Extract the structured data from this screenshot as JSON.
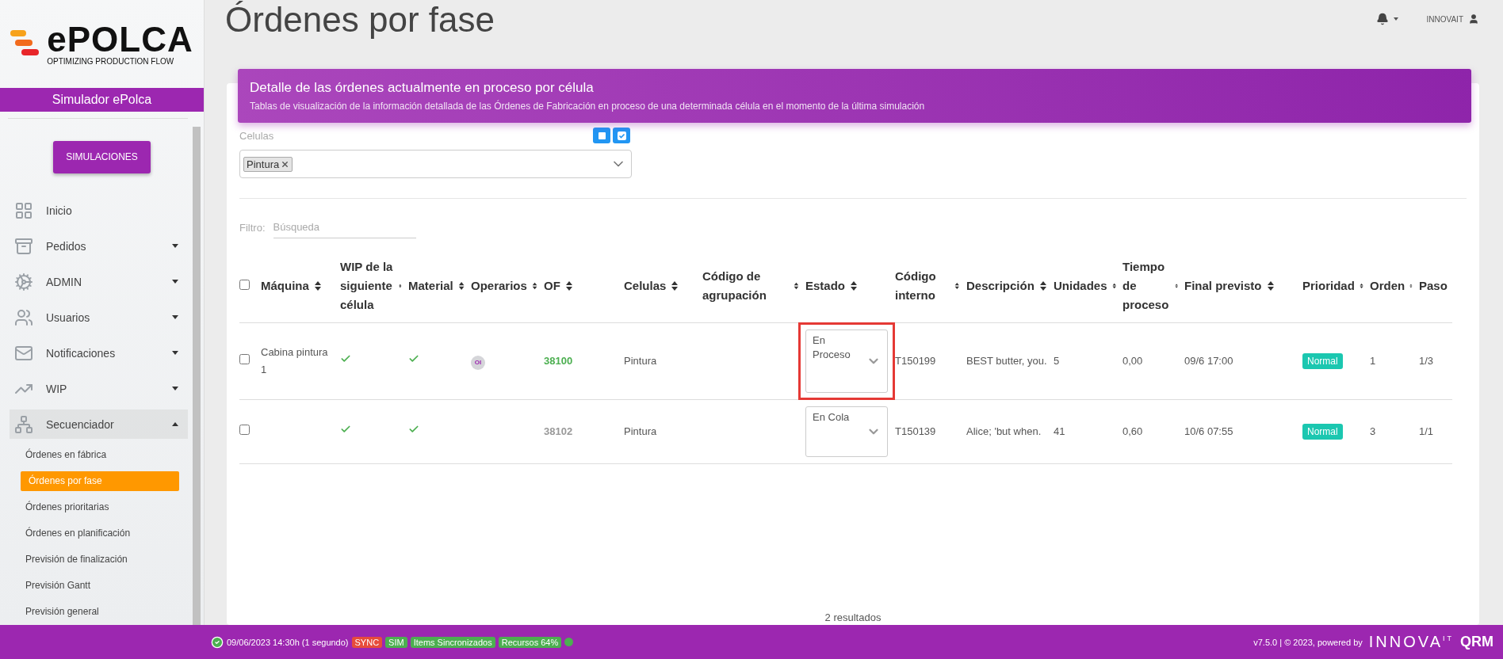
{
  "brand": {
    "name": "ePOLCA",
    "tagline": "OPTIMIZING PRODUCTION FLOW"
  },
  "sidebar": {
    "title": "Simulador ePolca",
    "button": "SIMULACIONES",
    "items": [
      {
        "label": "Inicio",
        "expandable": false,
        "expanded": false
      },
      {
        "label": "Pedidos",
        "expandable": true,
        "expanded": false
      },
      {
        "label": "ADMIN",
        "expandable": true,
        "expanded": false
      },
      {
        "label": "Usuarios",
        "expandable": true,
        "expanded": false
      },
      {
        "label": "Notificaciones",
        "expandable": true,
        "expanded": false
      },
      {
        "label": "WIP",
        "expandable": true,
        "expanded": false
      },
      {
        "label": "Secuenciador",
        "expandable": true,
        "expanded": true,
        "children": [
          {
            "label": "Órdenes en fábrica",
            "selected": false
          },
          {
            "label": "Órdenes por fase",
            "selected": true
          },
          {
            "label": "Órdenes prioritarias",
            "selected": false
          },
          {
            "label": "Órdenes en planificación",
            "selected": false
          },
          {
            "label": "Previsión de finalización",
            "selected": false
          },
          {
            "label": "Previsión Gantt",
            "selected": false
          },
          {
            "label": "Previsión general",
            "selected": false
          }
        ]
      }
    ]
  },
  "page_title": "Órdenes por fase",
  "topbar": {
    "user": "INNOVAIT"
  },
  "banner": {
    "title": "Detalle de las órdenes actualmente en proceso por célula",
    "subtitle": "Tablas de visualización de la información detallada de las Órdenes de Fabricación en proceso de una determinada célula en el momento de la última simulación"
  },
  "cell_filter": {
    "label": "Celulas",
    "tags": [
      "Pintura"
    ]
  },
  "search": {
    "label": "Filtro:",
    "placeholder": "Búsqueda"
  },
  "table": {
    "all_checked": false,
    "columns": [
      "Máquina",
      "WIP de la siguiente célula",
      "Material",
      "Operarios",
      "OF",
      "Celulas",
      "Código de agrupación",
      "Estado",
      "Código interno",
      "Descripción",
      "Unidades",
      "Tiempo de proceso",
      "Final previsto",
      "Prioridad",
      "Orden",
      "Paso"
    ],
    "rows": [
      {
        "checked": false,
        "machine": "Cabina pintura 1",
        "wip_ok": true,
        "material_ok": true,
        "operators": "OI",
        "of": "38100",
        "of_active": true,
        "cell": "Pintura",
        "state": "En Proceso",
        "highlighted": true,
        "internal_code": "T150199",
        "description": "BEST butter, you.",
        "units": "5",
        "process_time": "0,00",
        "final": "09/6 17:00",
        "priority": "Normal",
        "order": "1",
        "step": "1/3"
      },
      {
        "checked": false,
        "wip_ok": true,
        "material_ok": true,
        "of": "38102",
        "of_active": false,
        "cell": "Pintura",
        "state": "En Cola",
        "highlighted": false,
        "internal_code": "T150139",
        "description": "Alice; 'but when.",
        "units": "41",
        "process_time": "0,60",
        "final": "10/6 07:55",
        "priority": "Normal",
        "order": "3",
        "step": "1/1"
      }
    ]
  },
  "results": "2 resultados",
  "footer": {
    "timestamp": "09/06/2023 14:30h (1 segundo)",
    "badges": [
      {
        "label": "SYNC",
        "color": "#e74c3c"
      },
      {
        "label": "SIM",
        "color": "#4caf50"
      },
      {
        "label": "Items Sincronizados",
        "color": "#4caf50"
      },
      {
        "label": "Recursos 64%",
        "color": "#4caf50"
      }
    ],
    "version": "v7.5.0 | © 2023, powered by",
    "partner": "INNOVA",
    "partner_suffix": "IT",
    "product": "QRM"
  }
}
